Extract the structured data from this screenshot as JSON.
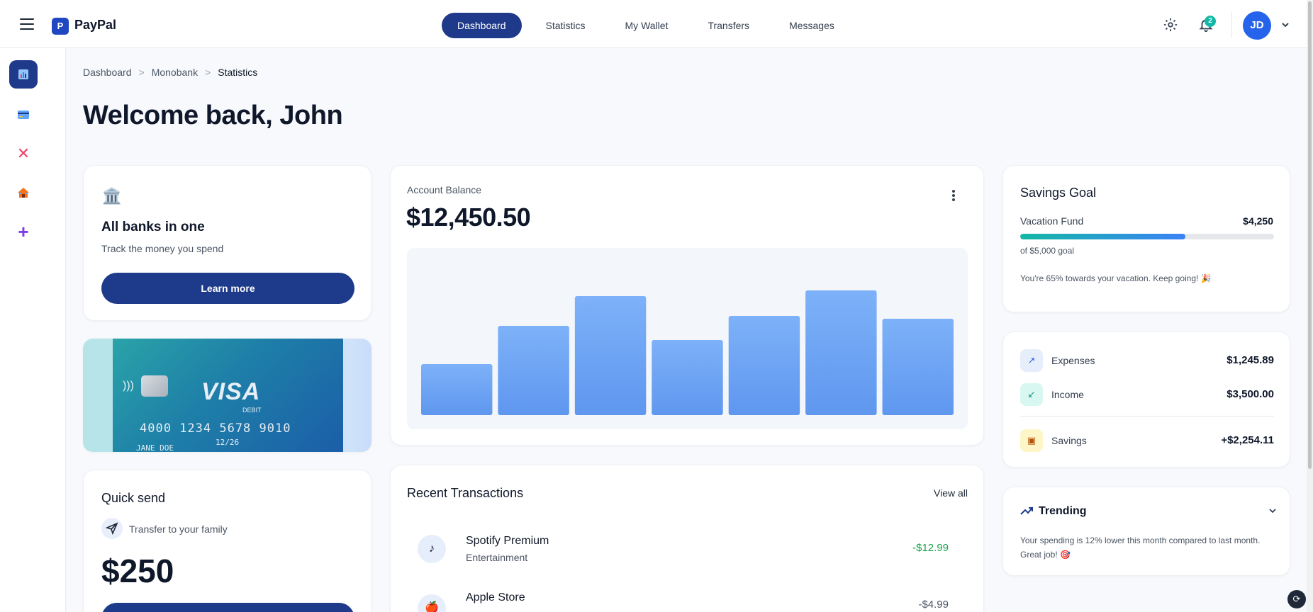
{
  "app": {
    "name": "PayPal",
    "logo_letter": "P"
  },
  "nav": [
    {
      "label": "Dashboard",
      "active": true
    },
    {
      "label": "Statistics"
    },
    {
      "label": "My Wallet"
    },
    {
      "label": "Transfers"
    },
    {
      "label": "Messages"
    }
  ],
  "header": {
    "notification_count": "2",
    "avatar_initials": "JD"
  },
  "sidebar": [
    {
      "icon": "bar-chart-icon",
      "glyph": "📊",
      "active": true
    },
    {
      "icon": "card-icon",
      "glyph": "💳"
    },
    {
      "icon": "x-icon",
      "glyph": "✕"
    },
    {
      "icon": "home-icon",
      "glyph": "🏠"
    },
    {
      "icon": "plus-icon",
      "glyph": "+"
    }
  ],
  "breadcrumb": {
    "items": [
      "Dashboard",
      "Monobank",
      "Statistics"
    ],
    "separator": ">"
  },
  "page_title": "Welcome back, John",
  "banks": {
    "icon": "🏛️",
    "title": "All banks in one",
    "subtitle": "Track the money you spend",
    "button": "Learn more"
  },
  "visa": {
    "brand": "VISA",
    "type": "DEBIT",
    "number": "4000 1234 5678 9010",
    "expiry": "12/26",
    "holder": "JANE DOE"
  },
  "quick_send": {
    "title": "Quick send",
    "subtitle": "Transfer to your family",
    "amount": "$250"
  },
  "balance": {
    "label": "Account Balance",
    "amount": "$12,450.50"
  },
  "chart_data": {
    "type": "bar",
    "categories": [
      "",
      "",
      "",
      "",
      "",
      "",
      ""
    ],
    "values": [
      36,
      63,
      84,
      53,
      70,
      88,
      68
    ],
    "ylim": [
      0,
      100
    ],
    "color": "#6aa4f6",
    "grid": false
  },
  "transactions": {
    "title": "Recent Transactions",
    "view_all": "View all",
    "items": [
      {
        "icon": "♪",
        "name": "Spotify Premium",
        "category": "Entertainment",
        "amount": "-$12.99"
      },
      {
        "icon": "🍎",
        "name": "Apple Store",
        "category": "",
        "amount": "-$4.99"
      }
    ]
  },
  "savings_goal": {
    "title": "Savings Goal",
    "fund": "Vacation Fund",
    "value": "$4,250",
    "progress": 0.65,
    "goal_text": "of $5,000 goal",
    "message": "You're 65% towards your vacation. Keep going! 🎉"
  },
  "stats": [
    {
      "label": "Expenses",
      "value": "$1,245.89",
      "icon": "arrow-up-right-icon",
      "glyph": "↗",
      "bg": "#e6eefc",
      "fg": "#2563eb"
    },
    {
      "label": "Income",
      "value": "$3,500.00",
      "icon": "arrow-down-left-icon",
      "glyph": "↙",
      "bg": "#d9f7f1",
      "fg": "#0d9488"
    },
    {
      "label": "Savings",
      "value": "+$2,254.11",
      "icon": "wallet-icon",
      "glyph": "▣",
      "bg": "#fef6c7",
      "fg": "#b45309"
    }
  ],
  "trending": {
    "title": "Trending",
    "text": "Your spending is 12% lower this month compared to last month. Great job! 🎯"
  }
}
